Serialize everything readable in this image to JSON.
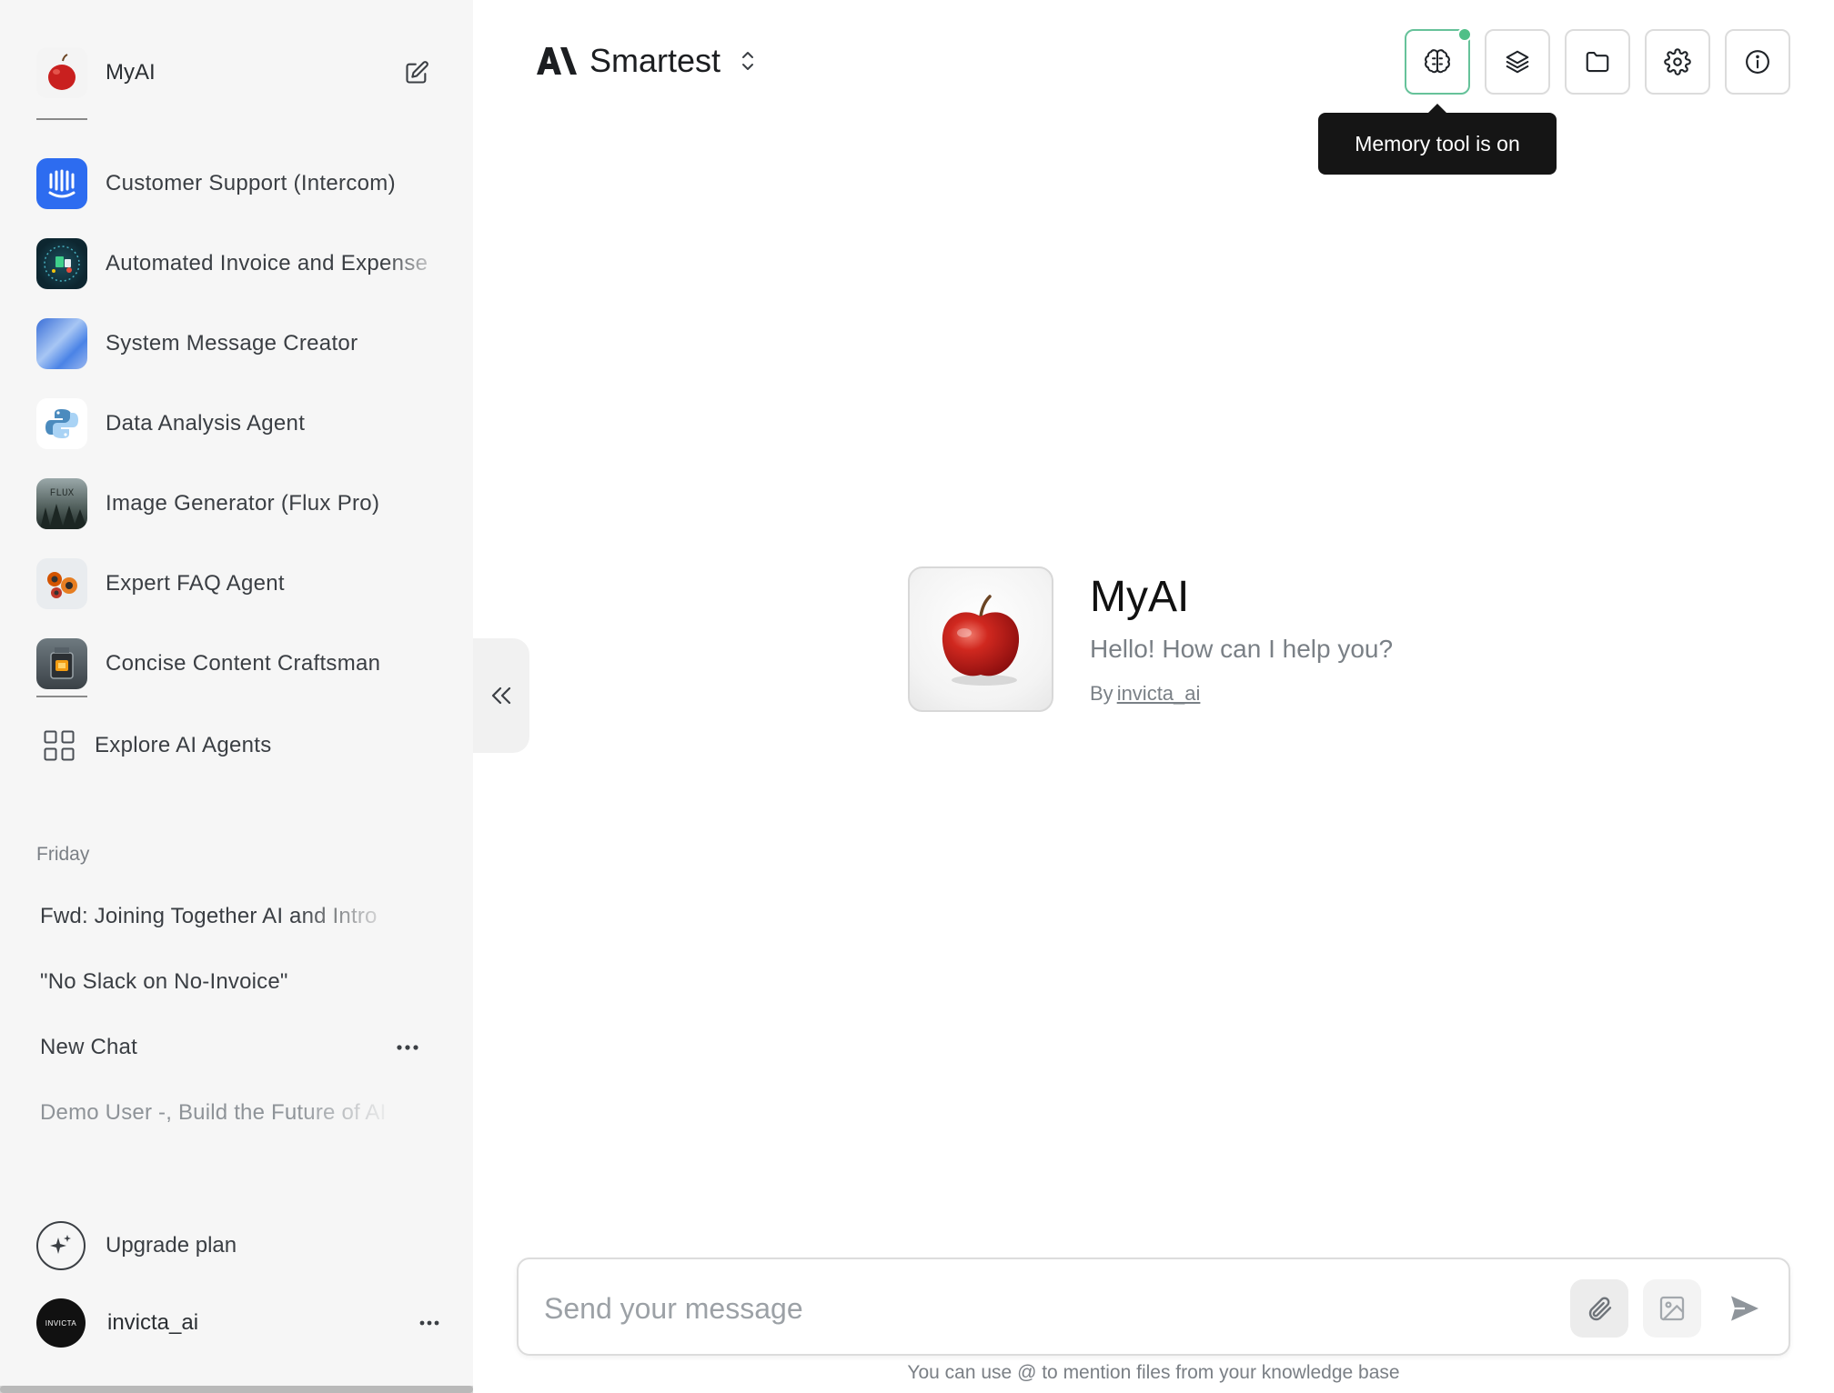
{
  "sidebar": {
    "current_agent": "MyAI",
    "agents": [
      {
        "label": "Customer Support (Intercom)",
        "icon": "intercom-icon"
      },
      {
        "label": "Automated Invoice and Expense",
        "icon": "invoice-icon"
      },
      {
        "label": "System Message Creator",
        "icon": "gradient-icon"
      },
      {
        "label": "Data Analysis Agent",
        "icon": "python-icon"
      },
      {
        "label": "Image Generator (Flux Pro)",
        "icon": "flux-icon"
      },
      {
        "label": "Expert FAQ Agent",
        "icon": "faq-icon"
      },
      {
        "label": "Concise Content Craftsman",
        "icon": "craftsman-icon"
      }
    ],
    "explore_label": "Explore AI Agents",
    "section_label": "Friday",
    "chats": [
      {
        "label": "Fwd: Joining Together AI and Intro"
      },
      {
        "label": "\"No Slack on No-Invoice\""
      },
      {
        "label": "New Chat"
      },
      {
        "label": "Demo User -, Build the Future of AI"
      }
    ],
    "upgrade_label": "Upgrade plan",
    "user_name": "invicta_ai",
    "user_avatar_text": "INVICTA"
  },
  "header": {
    "model_name": "Smartest",
    "tooltip": "Memory tool is on",
    "memory_indicator_color": "#4fbf87"
  },
  "main": {
    "agent_name": "MyAI",
    "greeting": "Hello! How can I help you?",
    "by_prefix": "By",
    "author": "invicta_ai"
  },
  "composer": {
    "placeholder": "Send your message",
    "hint": "You can use @ to mention files from your knowledge base"
  }
}
